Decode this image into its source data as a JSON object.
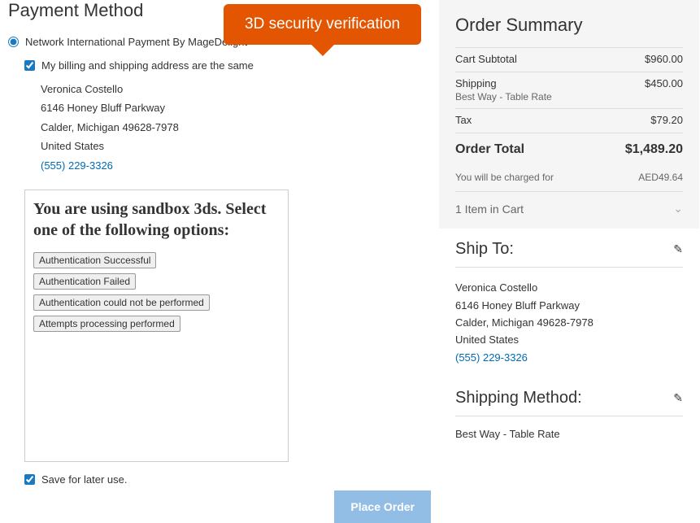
{
  "tooltip": {
    "label": "3D security verification"
  },
  "payment": {
    "title": "Payment Method",
    "method_label": "Network International Payment By MageDelight",
    "same_address_label": "My billing and shipping address are the same",
    "billing_address": {
      "name": "Veronica Costello",
      "street": "6146 Honey Bluff Parkway",
      "citystate": "Calder, Michigan 49628-7978",
      "country": "United States",
      "phone": "(555) 229-3326"
    },
    "sandbox": {
      "title": "You are using sandbox 3ds. Select one of the following options:",
      "btn1": "Authentication Successful",
      "btn2": "Authentication Failed",
      "btn3": "Authentication could not be performed",
      "btn4": "Attempts processing performed"
    },
    "save_label": "Save for later use.",
    "place_order": "Place Order"
  },
  "summary": {
    "title": "Order Summary",
    "subtotal_label": "Cart Subtotal",
    "subtotal_value": "$960.00",
    "shipping_label": "Shipping",
    "shipping_sub": "Best Way - Table Rate",
    "shipping_value": "$450.00",
    "tax_label": "Tax",
    "tax_value": "$79.20",
    "total_label": "Order Total",
    "total_value": "$1,489.20",
    "charged_label": "You will be charged for",
    "charged_value": "AED49.64",
    "item_count": "1 Item in Cart"
  },
  "shipto": {
    "title": "Ship To:",
    "address": {
      "name": "Veronica Costello",
      "street": "6146 Honey Bluff Parkway",
      "citystate": "Calder, Michigan 49628-7978",
      "country": "United States",
      "phone": "(555) 229-3326"
    }
  },
  "shipmethod": {
    "title": "Shipping Method:",
    "value": "Best Way - Table Rate"
  }
}
